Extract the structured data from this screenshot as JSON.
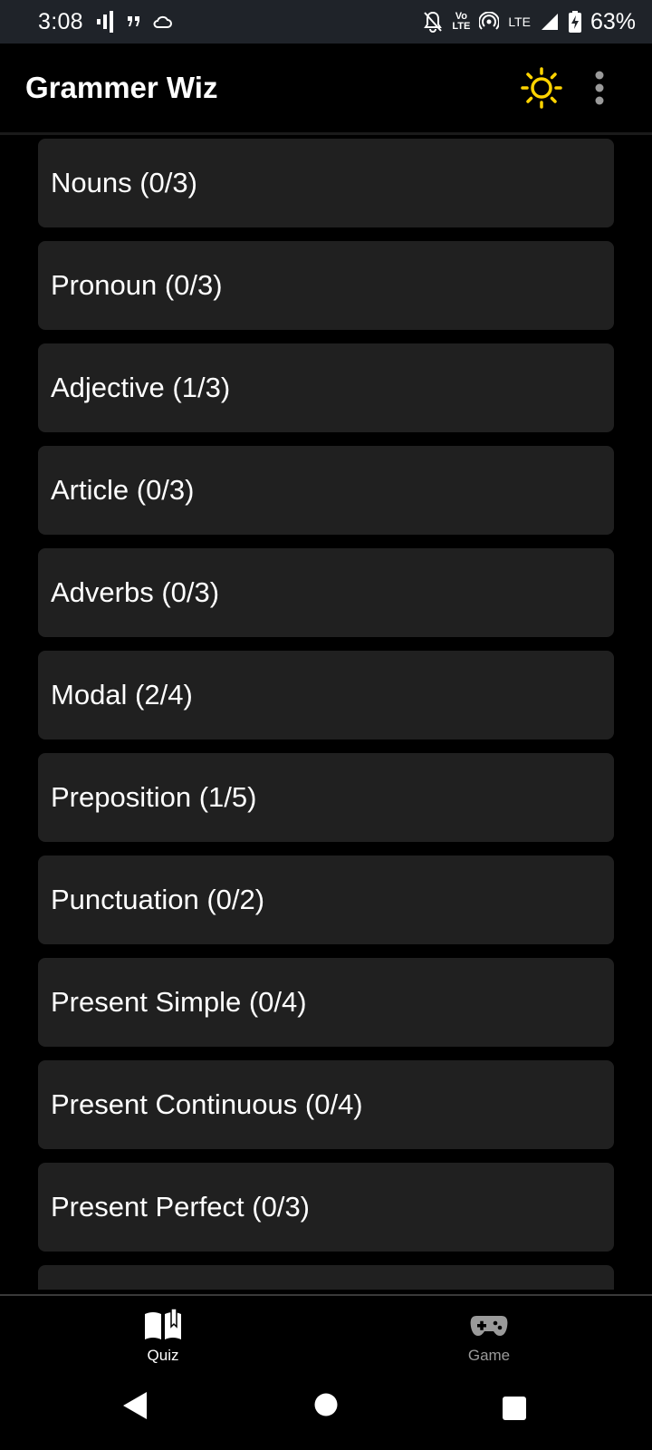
{
  "status_bar": {
    "time": "3:08",
    "network_label": "LTE",
    "volte_top": "Vo",
    "volte_bottom": "LTE",
    "battery": "63%"
  },
  "app_bar": {
    "title": "Grammer Wiz"
  },
  "topics": [
    {
      "label": "Nouns (0/3)"
    },
    {
      "label": "Pronoun (0/3)"
    },
    {
      "label": "Adjective (1/3)"
    },
    {
      "label": "Article (0/3)"
    },
    {
      "label": "Adverbs (0/3)"
    },
    {
      "label": "Modal (2/4)"
    },
    {
      "label": "Preposition (1/5)"
    },
    {
      "label": "Punctuation (0/2)"
    },
    {
      "label": "Present Simple (0/4)"
    },
    {
      "label": "Present Continuous (0/4)"
    },
    {
      "label": "Present Perfect (0/3)"
    },
    {
      "label": ""
    }
  ],
  "bottom_nav": {
    "quiz_label": "Quiz",
    "game_label": "Game"
  },
  "colors": {
    "accent_sun": "#FFD400",
    "card_bg": "#202020",
    "status_bar_bg": "#1f2329"
  }
}
